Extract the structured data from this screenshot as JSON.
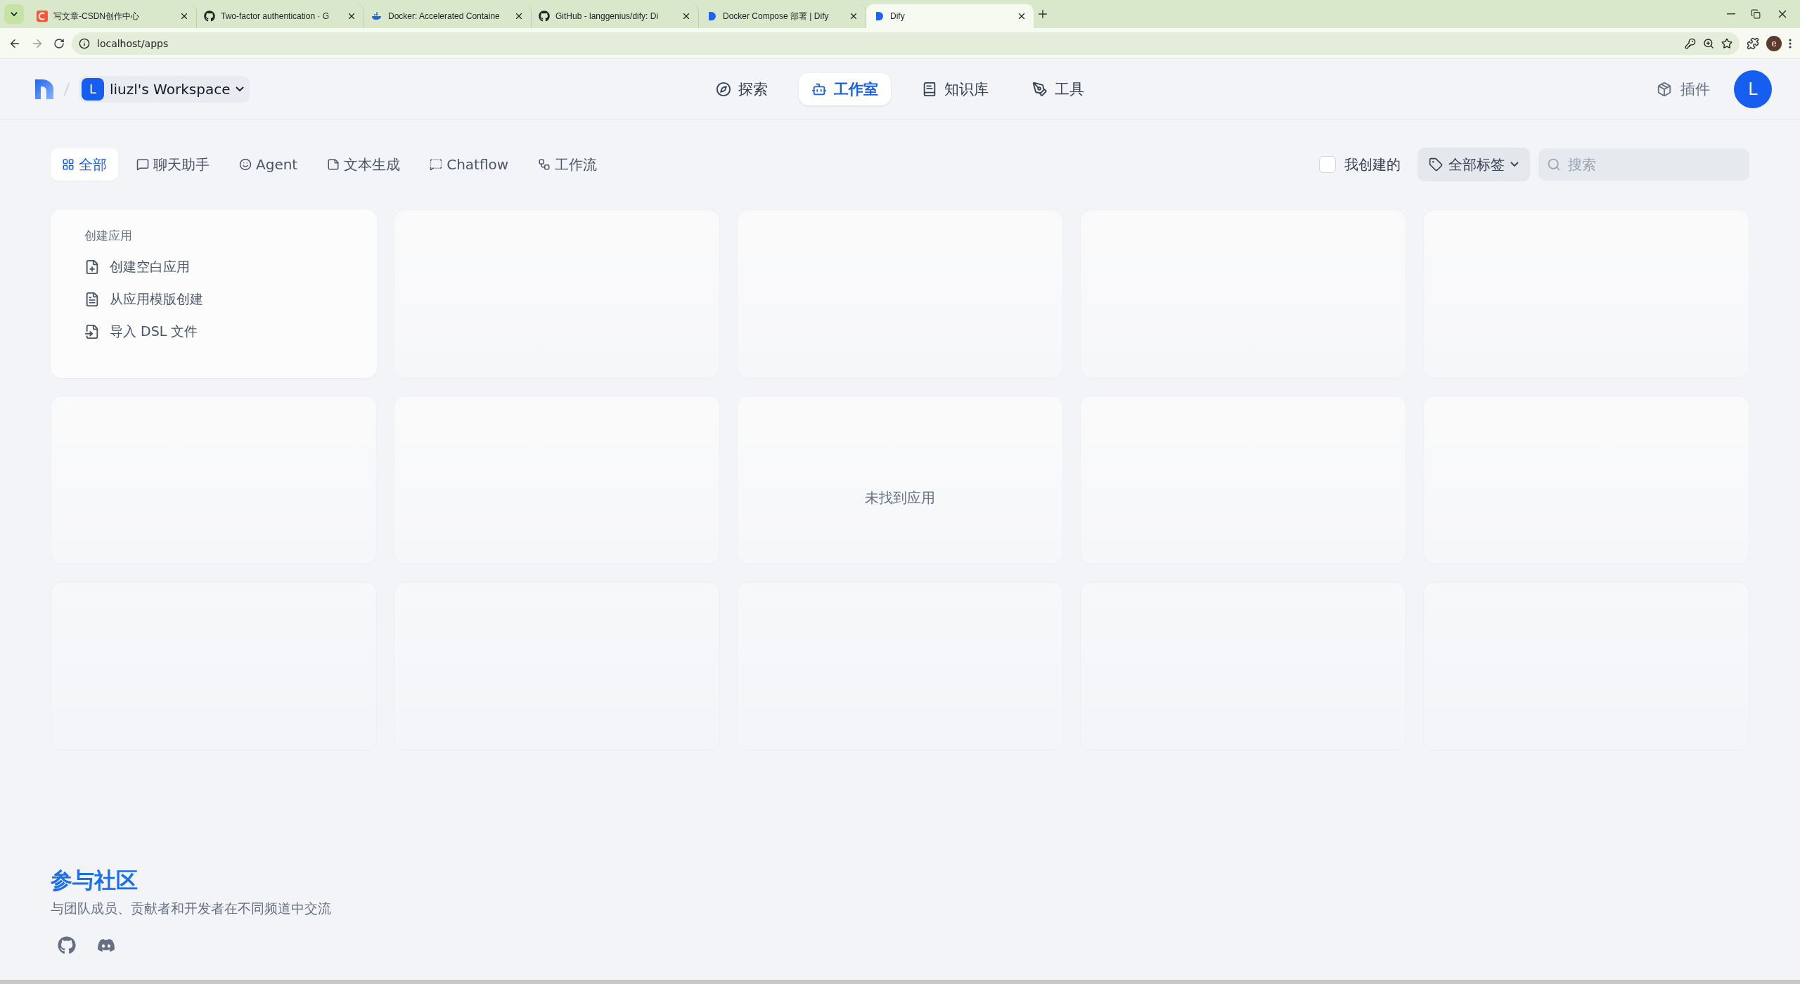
{
  "browser": {
    "tabs": [
      {
        "title": "写文章-CSDN创作中心",
        "selected": false
      },
      {
        "title": "Two-factor authentication · G",
        "selected": false
      },
      {
        "title": "Docker: Accelerated Containe",
        "selected": false
      },
      {
        "title": "GitHub - langgenius/dify: Di",
        "selected": false
      },
      {
        "title": "Docker Compose 部署 | Dify",
        "selected": false
      },
      {
        "title": "Dify",
        "selected": true
      }
    ],
    "url": "localhost/apps",
    "profile": "e"
  },
  "header": {
    "workspace": {
      "badge": "L",
      "name": "liuzl's Workspace"
    },
    "nav": [
      {
        "label": "探索",
        "selected": false
      },
      {
        "label": "工作室",
        "selected": true
      },
      {
        "label": "知识库",
        "selected": false
      },
      {
        "label": "工具",
        "selected": false
      }
    ],
    "plugins": "插件",
    "avatar": "L"
  },
  "filters": {
    "tabs": [
      {
        "label": "全部",
        "selected": true
      },
      {
        "label": "聊天助手",
        "selected": false
      },
      {
        "label": "Agent",
        "selected": false
      },
      {
        "label": "文本生成",
        "selected": false
      },
      {
        "label": "Chatflow",
        "selected": false
      },
      {
        "label": "工作流",
        "selected": false
      }
    ],
    "mine": {
      "label": "我创建的",
      "checked": false
    },
    "tags": "全部标签",
    "search": {
      "placeholder": "搜索"
    }
  },
  "create_card": {
    "title": "创建应用",
    "actions": [
      "创建空白应用",
      "从应用模版创建",
      "导入 DSL 文件"
    ]
  },
  "placeholders": [
    {
      "kind": "blank"
    },
    {
      "kind": "blank"
    },
    {
      "kind": "blank"
    },
    {
      "kind": "blank"
    },
    {
      "kind": "blank"
    },
    {
      "kind": "blank"
    },
    {
      "kind": "message",
      "text": "未找到应用"
    },
    {
      "kind": "blank"
    },
    {
      "kind": "blank"
    },
    {
      "kind": "blank"
    },
    {
      "kind": "blank"
    },
    {
      "kind": "blank"
    },
    {
      "kind": "blank"
    },
    {
      "kind": "blank"
    }
  ],
  "community": {
    "title": "参与社区",
    "subtitle": "与团队成员、贡献者和开发者在不同频道中交流"
  }
}
